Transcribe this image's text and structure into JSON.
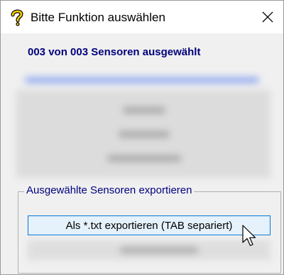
{
  "window": {
    "title": "Bitte Funktion auswählen",
    "icon": "question-mark-icon",
    "close_icon": "close-icon"
  },
  "selection": {
    "status_text": "003 von 003 Sensoren ausgewählt"
  },
  "export_group": {
    "title": "Ausgewählte Sensoren exportieren",
    "txt_button_label": "Als *.txt exportieren (TAB separiert)"
  },
  "colors": {
    "accent_text": "#00007d",
    "button_focus_border": "#0078d7",
    "button_hover_bg": "#e5f1fb"
  }
}
